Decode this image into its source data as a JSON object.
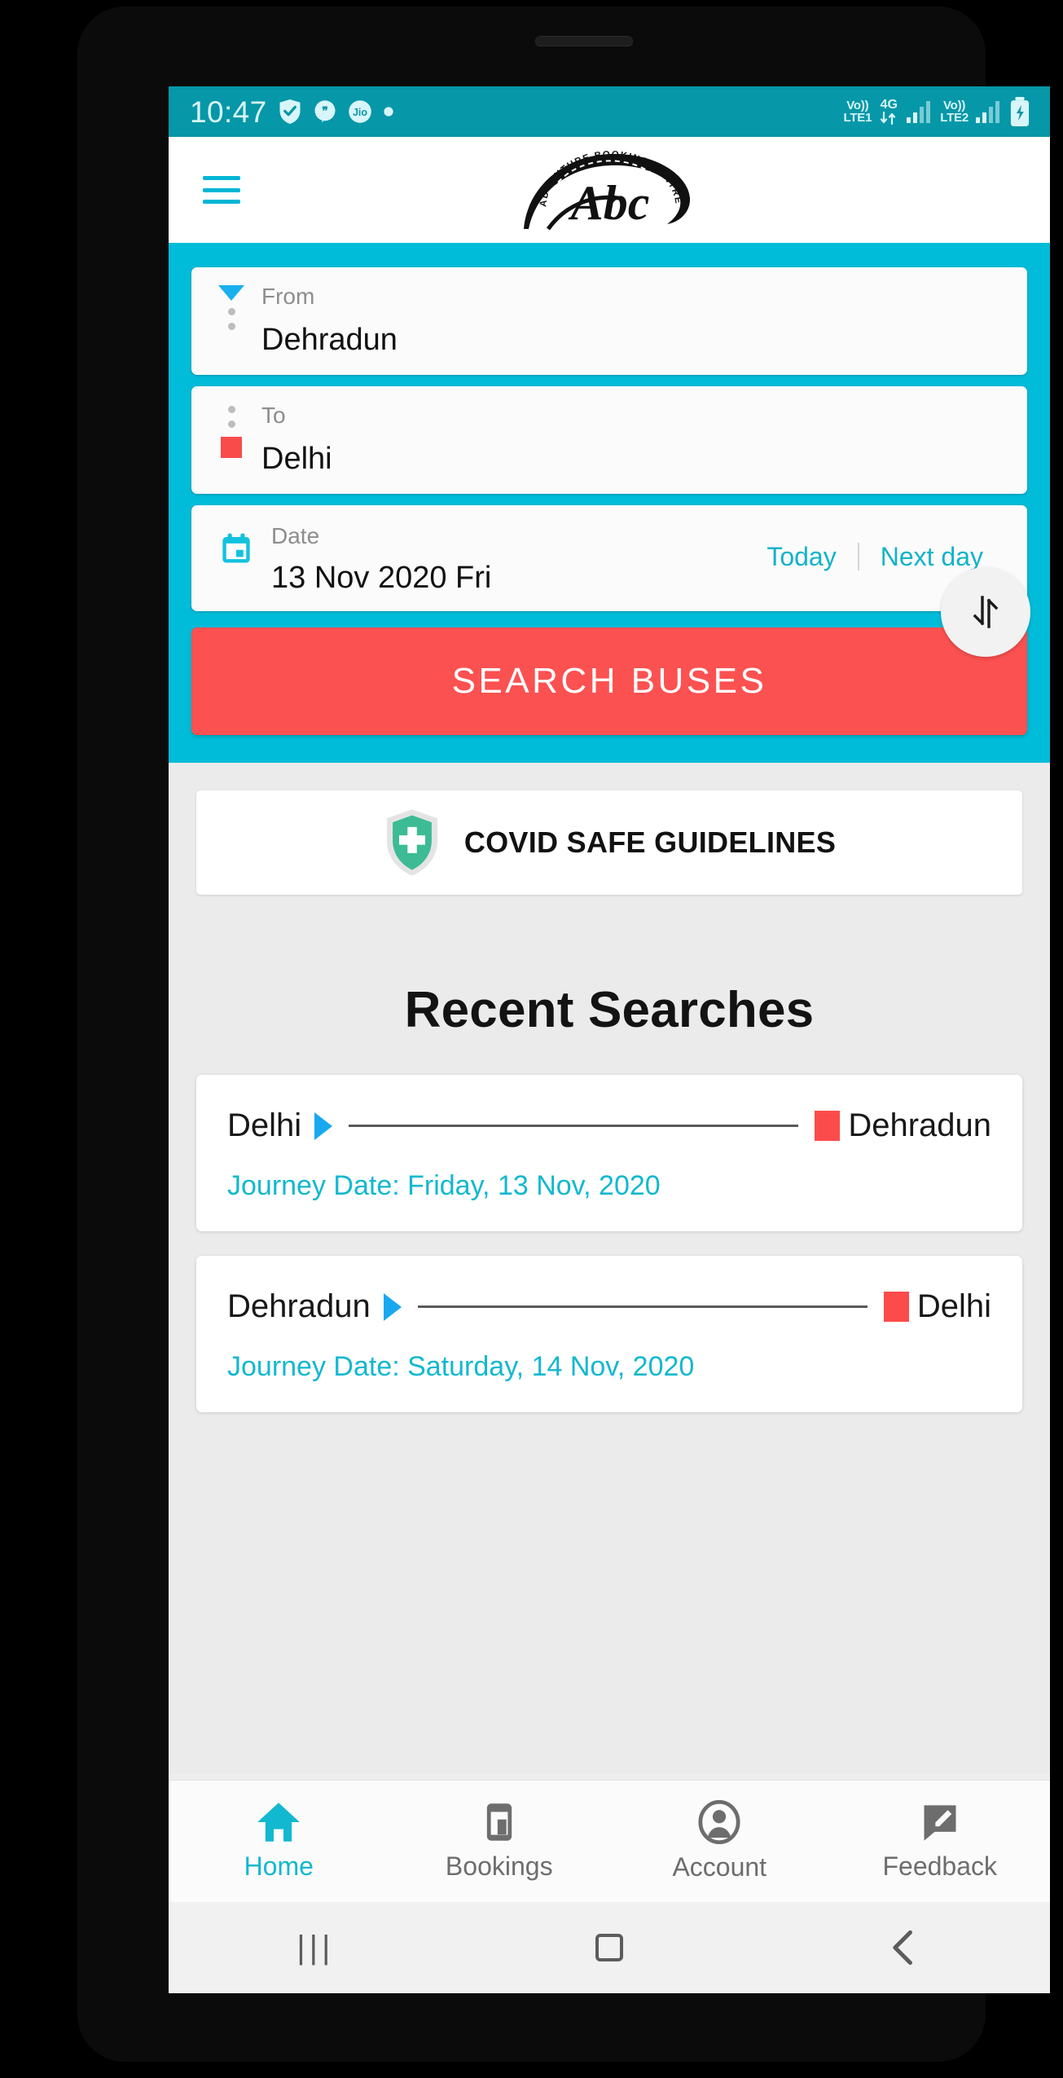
{
  "status_bar": {
    "time": "10:47",
    "left_icons": [
      "shield-check-icon",
      "chat-quote-icon",
      "jio-icon",
      "dot-indicator-icon"
    ],
    "sim1_label_top": "Vo))",
    "sim1_label_bottom": "LTE1",
    "network_type": "4G",
    "sim2_label_top": "Vo))",
    "sim2_label_bottom": "LTE2",
    "battery": "charging",
    "background_color": "#0697a8",
    "text_color": "#d8f6fa"
  },
  "header": {
    "menu_icon": "hamburger-menu-icon",
    "logo_arc_text": "ADVENTURE BOOKING CENTRE",
    "logo_script_text": "Abc",
    "menu_color": "#00b6d4"
  },
  "search_panel": {
    "background_color": "#00bcd9",
    "from": {
      "label": "From",
      "value": "Dehradun",
      "marker": "triangle-down-marker"
    },
    "to": {
      "label": "To",
      "value": "Delhi",
      "marker": "square-red-marker"
    },
    "date": {
      "label": "Date",
      "value": "13 Nov 2020 Fri",
      "icon": "calendar-icon",
      "today_label": "Today",
      "next_day_label": "Next day",
      "action_color": "#12b3c8"
    },
    "swap_button": {
      "icon": "swap-vertical-arrows-icon"
    },
    "search_button": {
      "label": "SEARCH BUSES",
      "color": "#fc5151"
    }
  },
  "covid_banner": {
    "label": "COVID SAFE GUIDELINES",
    "icon": "shield-health-cross-icon",
    "icon_color": "#3cbb94"
  },
  "recent": {
    "title": "Recent Searches",
    "cards": [
      {
        "origin": "Delhi",
        "destination": "Dehradun",
        "journey_date": "Journey Date: Friday, 13 Nov, 2020"
      },
      {
        "origin": "Dehradun",
        "destination": "Delhi",
        "journey_date": "Journey Date: Saturday, 14 Nov, 2020"
      }
    ]
  },
  "bottom_nav": {
    "active_color": "#12b8cf",
    "inactive_color": "#6d6d6d",
    "items": [
      {
        "label": "Home",
        "icon": "home-icon",
        "active": true
      },
      {
        "label": "Bookings",
        "icon": "ticket-phone-icon",
        "active": false
      },
      {
        "label": "Account",
        "icon": "account-circle-icon",
        "active": false
      },
      {
        "label": "Feedback",
        "icon": "feedback-edit-icon",
        "active": false
      }
    ]
  },
  "system_nav": {
    "recents": "|||",
    "home": "home-square-icon",
    "back": "back-chevron-icon"
  }
}
